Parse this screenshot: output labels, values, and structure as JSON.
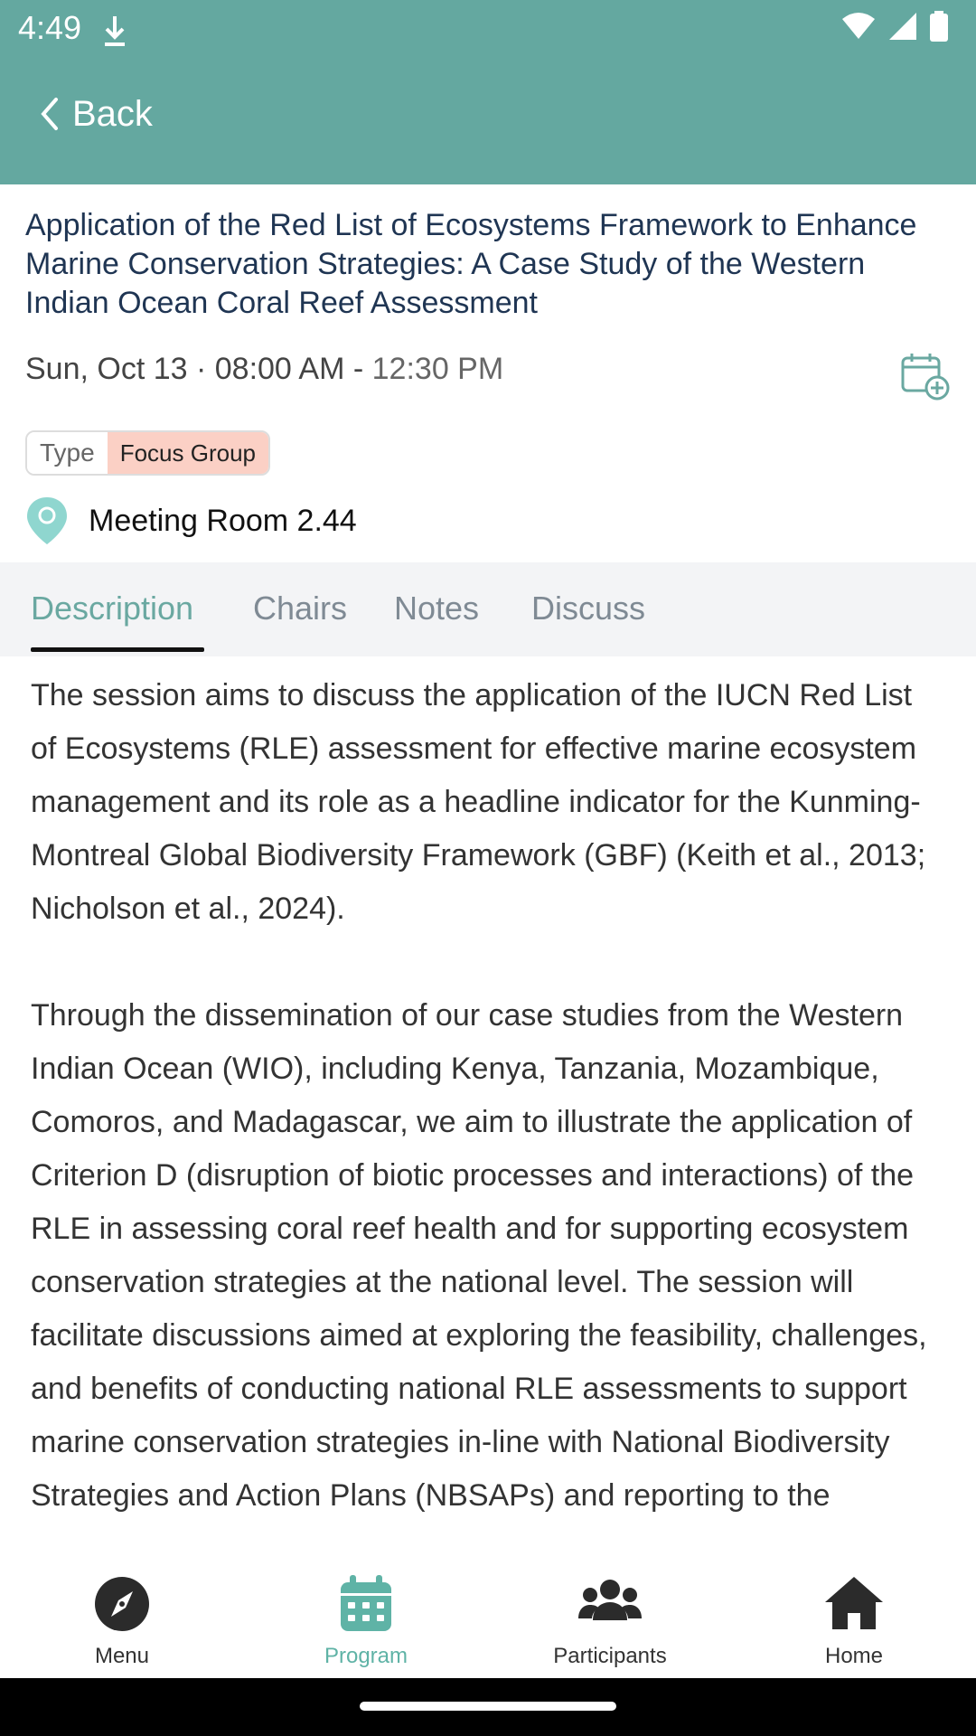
{
  "status_bar": {
    "time": "4:49"
  },
  "header": {
    "back_label": "Back"
  },
  "session": {
    "title": "Application of the Red List of Ecosystems Framework to Enhance Marine Conservation Strategies: A Case Study of the Western Indian Ocean Coral Reef Assessment",
    "date_start": "Sun, Oct 13 · 08:00 AM - ",
    "time_end": "12:30 PM",
    "type_label": "Type",
    "type_value": "Focus Group",
    "location": "Meeting Room 2.44"
  },
  "tabs": [
    {
      "label": "Description",
      "active": true
    },
    {
      "label": "Chairs",
      "active": false
    },
    {
      "label": "Notes",
      "active": false
    },
    {
      "label": "Discuss",
      "active": false
    }
  ],
  "description": {
    "paragraph1": "The session aims to discuss the application of the IUCN Red List of Ecosystems (RLE) assessment for effective marine ecosystem management and its role as a headline indicator for the Kunming-Montreal Global Biodiversity Framework (GBF) (Keith et al., 2013; Nicholson et al., 2024).",
    "paragraph2": "Through the dissemination of our case studies from the Western Indian Ocean (WIO), including Kenya, Tanzania, Mozambique, Comoros, and Madagascar, we aim to illustrate the application of Criterion D (disruption of biotic processes and interactions) of the RLE in assessing coral reef health and for supporting ecosystem conservation strategies at the national level. The session will facilitate discussions aimed at exploring the feasibility, challenges, and benefits of conducting national RLE assessments to support marine conservation strategies in-line with National Biodiversity Strategies and Action Plans (NBSAPs) and reporting to the"
  },
  "bottom_nav": [
    {
      "label": "Menu",
      "icon": "compass-icon",
      "active": false
    },
    {
      "label": "Program",
      "icon": "calendar-icon",
      "active": true
    },
    {
      "label": "Participants",
      "icon": "people-icon",
      "active": false
    },
    {
      "label": "Home",
      "icon": "home-icon",
      "active": false
    }
  ],
  "colors": {
    "header_bg": "#64a8a0",
    "accent": "#5fb3a6",
    "type_badge": "#fbd0c5",
    "title_text": "#1f3553"
  }
}
